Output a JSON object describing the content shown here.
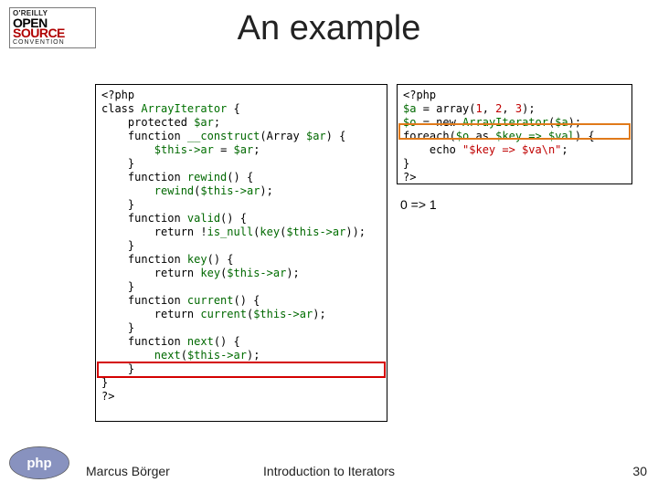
{
  "logo_osc": {
    "line1": "O'REILLY",
    "line2": "OPEN",
    "line3": "SOURCE",
    "line4": "CONVENTION"
  },
  "title": "An example",
  "code_left": {
    "l01": "<?php",
    "l02a": "class ",
    "l02b": "ArrayIterator ",
    "l02c": "{",
    "l03a": "    protected ",
    "l03b": "$ar",
    "l03c": ";",
    "l04a": "    function ",
    "l04b": "__construct",
    "l04c": "(Array ",
    "l04d": "$ar",
    "l04e": ") {",
    "l05a": "        ",
    "l05b": "$this",
    "l05c": "->",
    "l05d": "ar ",
    "l05e": "= ",
    "l05f": "$ar",
    "l05g": ";",
    "l06": "    }",
    "l07a": "    function ",
    "l07b": "rewind",
    "l07c": "() {",
    "l08a": "        ",
    "l08b": "rewind",
    "l08c": "(",
    "l08d": "$this",
    "l08e": "->",
    "l08f": "ar",
    "l08g": ");",
    "l09": "    }",
    "l10a": "    function ",
    "l10b": "valid",
    "l10c": "() {",
    "l11a": "        return !",
    "l11b": "is_null",
    "l11c": "(",
    "l11d": "key",
    "l11e": "(",
    "l11f": "$this",
    "l11g": "->",
    "l11h": "ar",
    "l11i": "));",
    "l12": "    }",
    "l13a": "    function ",
    "l13b": "key",
    "l13c": "() {",
    "l14a": "        return ",
    "l14b": "key",
    "l14c": "(",
    "l14d": "$this",
    "l14e": "->",
    "l14f": "ar",
    "l14g": ");",
    "l15": "    }",
    "l16a": "    function ",
    "l16b": "current",
    "l16c": "() {",
    "l17a": "        return ",
    "l17b": "current",
    "l17c": "(",
    "l17d": "$this",
    "l17e": "->",
    "l17f": "ar",
    "l17g": ");",
    "l18": "    }",
    "l19a": "    function ",
    "l19b": "next",
    "l19c": "() {",
    "l20a": "        ",
    "l20b": "next",
    "l20c": "(",
    "l20d": "$this",
    "l20e": "->",
    "l20f": "ar",
    "l20g": ");",
    "l21": "    }",
    "l22": "}",
    "l23": "?>"
  },
  "code_right": {
    "l01": "<?php",
    "l02a": "$a ",
    "l02b": "= array(",
    "l02c": "1",
    "l02d": ", ",
    "l02e": "2",
    "l02f": ", ",
    "l02g": "3",
    "l02h": ");",
    "l03a": "$o ",
    "l03b": "= new ",
    "l03c": "ArrayIterator",
    "l03d": "(",
    "l03e": "$a",
    "l03f": ");",
    "l04a": "foreach(",
    "l04b": "$o ",
    "l04c": "as ",
    "l04d": "$key ",
    "l04e": "=> ",
    "l04f": "$val",
    "l04g": ") {",
    "l05a": "    echo ",
    "l05b": "\"$key => $va\\n\"",
    "l05c": ";",
    "l06": "}",
    "l07": "?>"
  },
  "output": "0 => 1",
  "footer": {
    "author": "Marcus Börger",
    "center": "Introduction to Iterators",
    "page": "30"
  }
}
